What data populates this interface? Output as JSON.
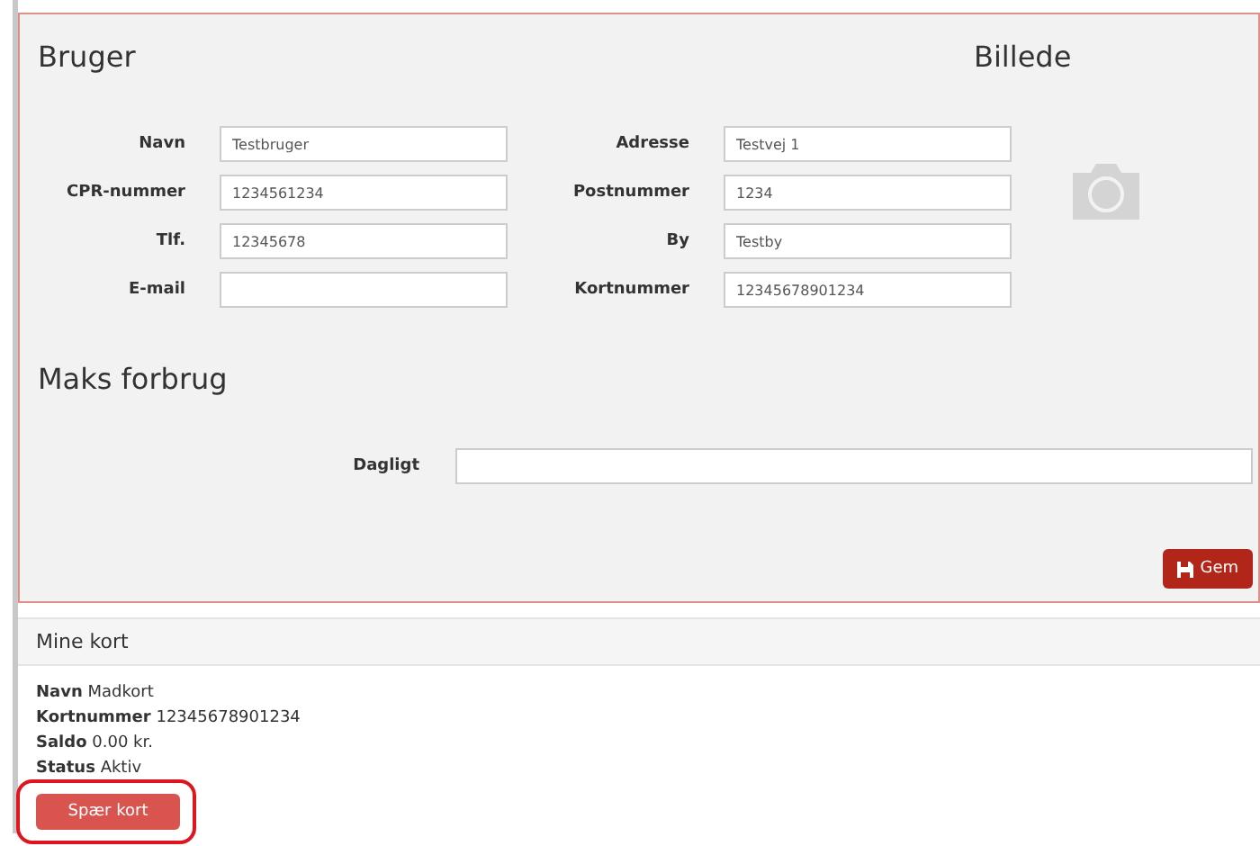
{
  "user_panel": {
    "title": "Bruger",
    "picture_title": "Billede",
    "fields": [
      {
        "label": "Navn",
        "value": "Testbruger"
      },
      {
        "label": "Adresse",
        "value": "Testvej 1"
      },
      {
        "label": "CPR-nummer",
        "value": "1234561234"
      },
      {
        "label": "Postnummer",
        "value": "1234"
      },
      {
        "label": "Tlf.",
        "value": "12345678"
      },
      {
        "label": "By",
        "value": "Testby"
      },
      {
        "label": "E-mail"
      },
      {
        "label": "Kortnummer",
        "value": "12345678901234"
      }
    ],
    "limit_title": "Maks forbrug",
    "daily": {
      "label": "Dagligt"
    },
    "save_button": "Gem"
  },
  "cards_panel": {
    "title": "Mine kort",
    "details": [
      {
        "label": "Navn",
        "value": "Madkort"
      },
      {
        "label": "Kortnummer",
        "value": "12345678901234"
      },
      {
        "label": "Saldo",
        "value": "0.00 kr."
      },
      {
        "label": "Status",
        "value": "Aktiv"
      }
    ],
    "block_button": "Spær kort",
    "highlighted": true
  }
}
